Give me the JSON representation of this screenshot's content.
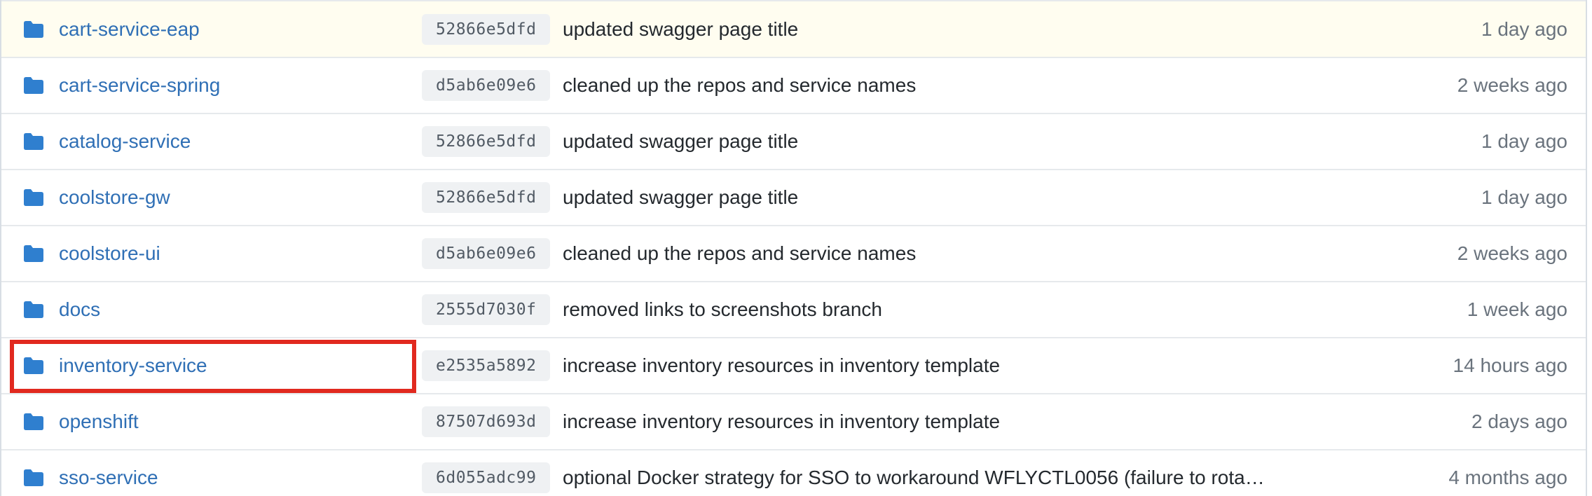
{
  "colors": {
    "link": "#2f6fb5",
    "folder_icon": "#2f7fcf",
    "highlight_row": "#fffdf0",
    "annotation_box": "#e1291f"
  },
  "rows": [
    {
      "name": "cart-service-eap",
      "sha": "52866e5dfd",
      "message": "updated swagger page title",
      "age": "1 day ago",
      "icon": "folder-icon"
    },
    {
      "name": "cart-service-spring",
      "sha": "d5ab6e09e6",
      "message": "cleaned up the repos and service names",
      "age": "2 weeks ago",
      "icon": "folder-icon"
    },
    {
      "name": "catalog-service",
      "sha": "52866e5dfd",
      "message": "updated swagger page title",
      "age": "1 day ago",
      "icon": "folder-icon"
    },
    {
      "name": "coolstore-gw",
      "sha": "52866e5dfd",
      "message": "updated swagger page title",
      "age": "1 day ago",
      "icon": "folder-icon"
    },
    {
      "name": "coolstore-ui",
      "sha": "d5ab6e09e6",
      "message": "cleaned up the repos and service names",
      "age": "2 weeks ago",
      "icon": "folder-icon"
    },
    {
      "name": "docs",
      "sha": "2555d7030f",
      "message": "removed links to screenshots branch",
      "age": "1 week ago",
      "icon": "folder-icon"
    },
    {
      "name": "inventory-service",
      "sha": "e2535a5892",
      "message": "increase inventory resources in inventory template",
      "age": "14 hours ago",
      "icon": "folder-icon"
    },
    {
      "name": "openshift",
      "sha": "87507d693d",
      "message": "increase inventory resources in inventory template",
      "age": "2 days ago",
      "icon": "folder-icon"
    },
    {
      "name": "sso-service",
      "sha": "6d055adc99",
      "message": "optional Docker strategy for SSO to workaround WFLYCTL0056 (failure to rota…",
      "age": "4 months ago",
      "icon": "folder-icon"
    }
  ]
}
